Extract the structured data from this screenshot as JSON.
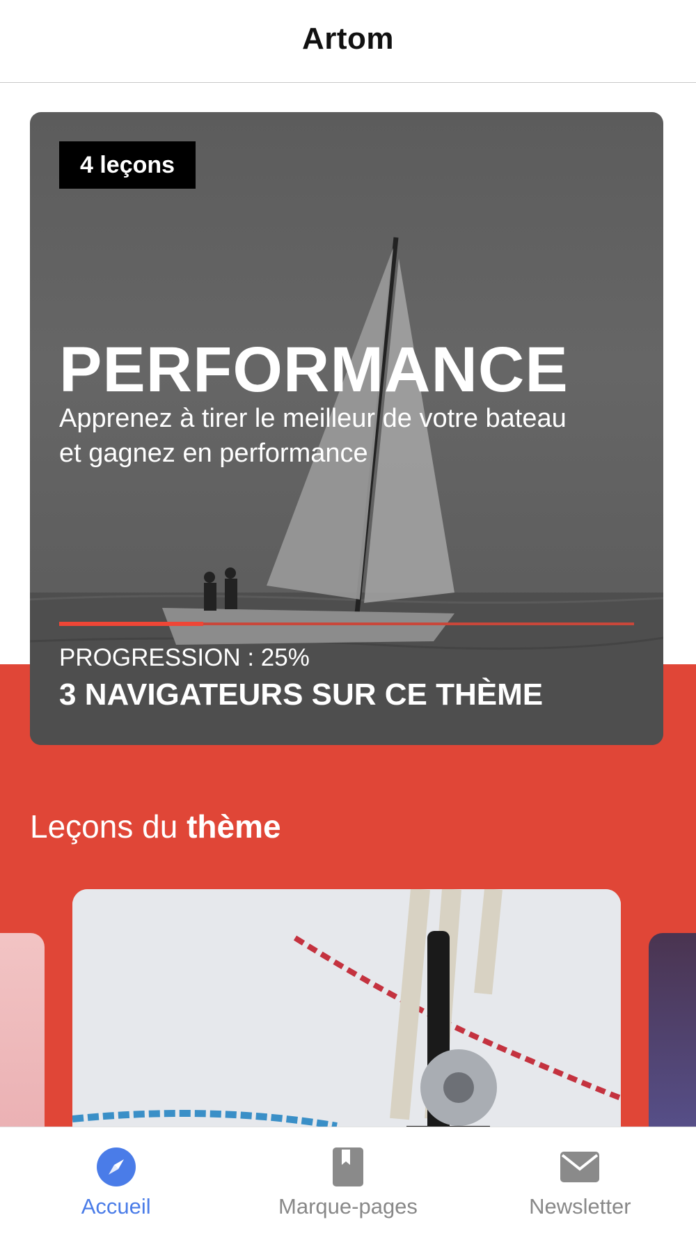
{
  "header": {
    "title": "Artom"
  },
  "theme_card": {
    "badge": "4 leçons",
    "title": "PERFORMANCE",
    "description": "Apprenez à tirer le meilleur de votre bateau et gagnez en performance",
    "progress_label": "PROGRESSION : 25%",
    "progress_value": 0.25,
    "navigators": "3 NAVIGATEURS SUR CE THÈME"
  },
  "section": {
    "title_regular": "Leçons du ",
    "title_bold": "thème"
  },
  "tabbar": {
    "tabs": [
      {
        "label": "Accueil",
        "icon": "compass-icon",
        "active": true
      },
      {
        "label": "Marque-pages",
        "icon": "bookmark-icon",
        "active": false
      },
      {
        "label": "Newsletter",
        "icon": "mail-icon",
        "active": false
      }
    ]
  },
  "colors": {
    "accent": "#e04637",
    "tab_active": "#4a7ce8",
    "tab_inactive": "#888888"
  }
}
